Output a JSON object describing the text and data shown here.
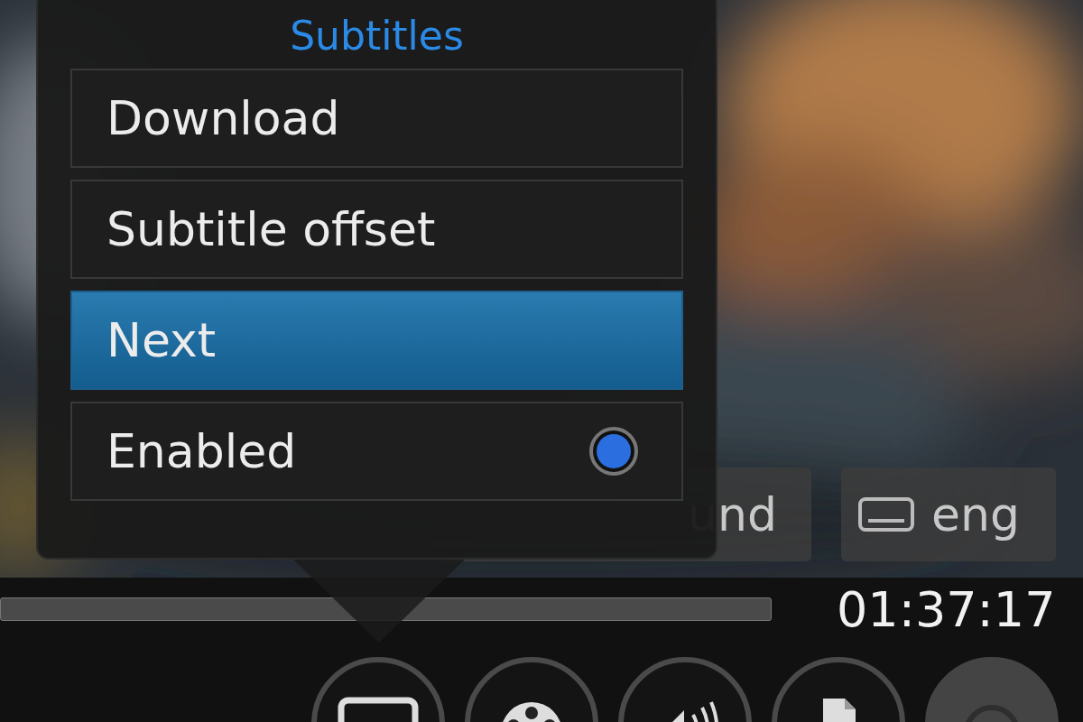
{
  "popup": {
    "title": "Subtitles",
    "items": [
      {
        "kind": "action",
        "label": "Download",
        "selected": false
      },
      {
        "kind": "action",
        "label": "Subtitle offset",
        "selected": false
      },
      {
        "kind": "action",
        "label": "Next",
        "selected": true
      },
      {
        "kind": "toggle",
        "label": "Enabled",
        "selected": false,
        "on": true
      }
    ]
  },
  "audio_chip": {
    "label": "und"
  },
  "subtitle_chip": {
    "label": "eng"
  },
  "progress": {
    "level": 0
  },
  "time": "01:37:17"
}
